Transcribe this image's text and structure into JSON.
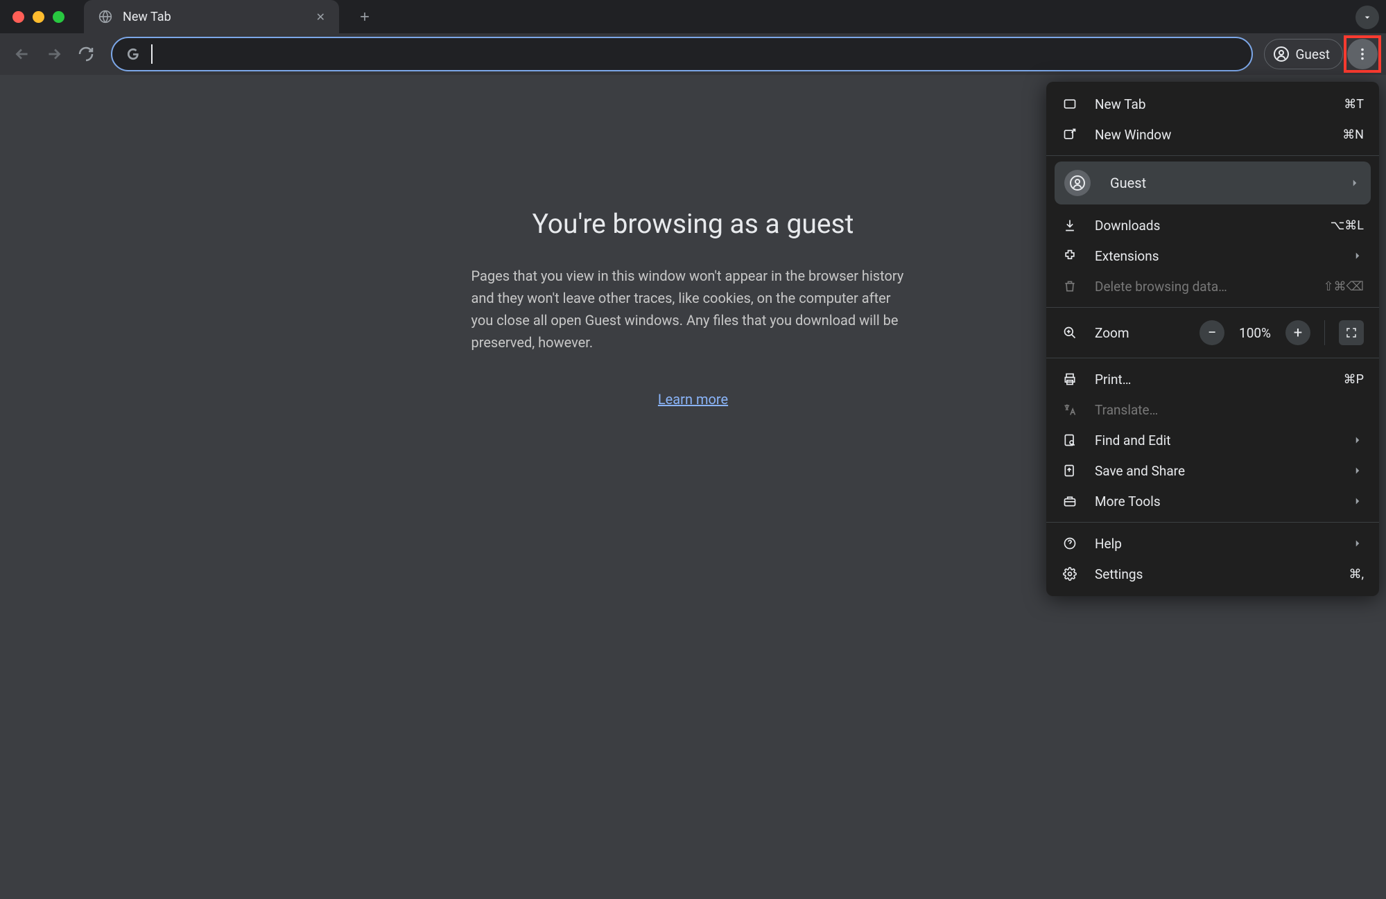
{
  "tab": {
    "title": "New Tab"
  },
  "profile": {
    "label": "Guest"
  },
  "page": {
    "heading": "You're browsing as a guest",
    "body": "Pages that you view in this window won't appear in the browser history and they won't leave other traces, like cookies, on the computer after you close all open Guest windows. Any files that you download will be preserved, however.",
    "learn_more": "Learn more"
  },
  "menu": {
    "new_tab": {
      "label": "New Tab",
      "shortcut": "⌘T"
    },
    "new_window": {
      "label": "New Window",
      "shortcut": "⌘N"
    },
    "guest": {
      "label": "Guest"
    },
    "downloads": {
      "label": "Downloads",
      "shortcut": "⌥⌘L"
    },
    "extensions": {
      "label": "Extensions"
    },
    "delete_data": {
      "label": "Delete browsing data…",
      "shortcut": "⇧⌘⌫"
    },
    "zoom": {
      "label": "Zoom",
      "value": "100%"
    },
    "print": {
      "label": "Print…",
      "shortcut": "⌘P"
    },
    "translate": {
      "label": "Translate…"
    },
    "find_edit": {
      "label": "Find and Edit"
    },
    "save_share": {
      "label": "Save and Share"
    },
    "more_tools": {
      "label": "More Tools"
    },
    "help": {
      "label": "Help"
    },
    "settings": {
      "label": "Settings",
      "shortcut": "⌘,"
    }
  }
}
